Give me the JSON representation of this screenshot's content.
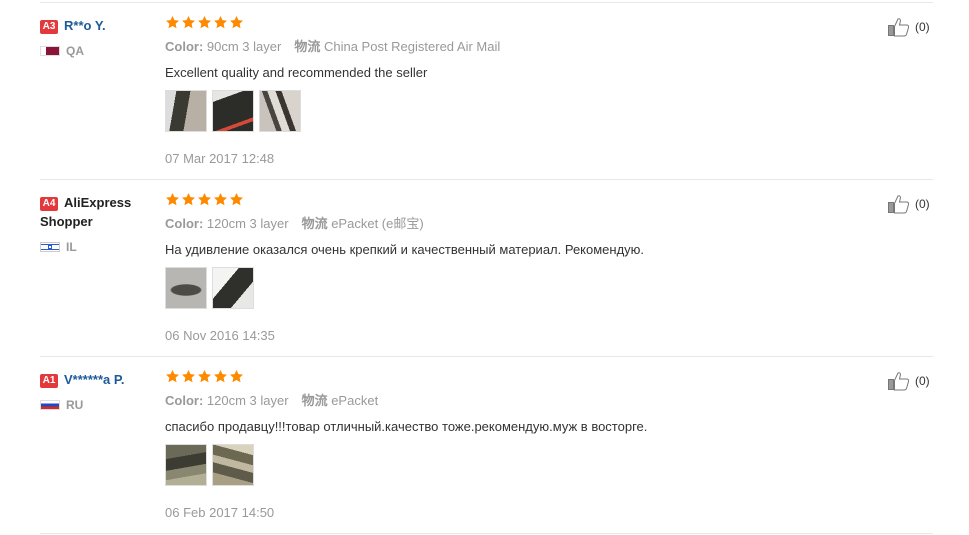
{
  "reviews": [
    {
      "level": "A3",
      "name": "R**o Y.",
      "country": "QA",
      "rating": 5,
      "color_label": "Color:",
      "color_value": "90cm 3 layer",
      "ship_label": "物流",
      "ship_value": "China Post Registered Air Mail",
      "text": "Excellent quality and recommended the seller",
      "date": "07 Mar 2017 12:48",
      "likes": "(0)"
    },
    {
      "level": "A4",
      "name": "AliExpress Shopper",
      "country": "IL",
      "rating": 5,
      "color_label": "Color:",
      "color_value": "120cm 3 layer",
      "ship_label": "物流",
      "ship_value": "ePacket (e邮宝)",
      "text": "На удивление оказался очень крепкий и качественный материал. Рекомендую.",
      "date": "06 Nov 2016 14:35",
      "likes": "(0)"
    },
    {
      "level": "A1",
      "name": "V******a P.",
      "country": "RU",
      "rating": 5,
      "color_label": "Color:",
      "color_value": "120cm 3 layer",
      "ship_label": "物流",
      "ship_value": "ePacket",
      "text": "спасибо продавцу!!!товар отличный.качество тоже.рекомендую.муж в восторге.",
      "date": "06 Feb 2017 14:50",
      "likes": "(0)"
    }
  ],
  "colors": {
    "star": "#ff8a00",
    "level_badge": "#e4393c",
    "name_link": "#1d5a9a"
  },
  "icons": {
    "vote": "thumbs-up-icon",
    "star": "star-icon"
  }
}
